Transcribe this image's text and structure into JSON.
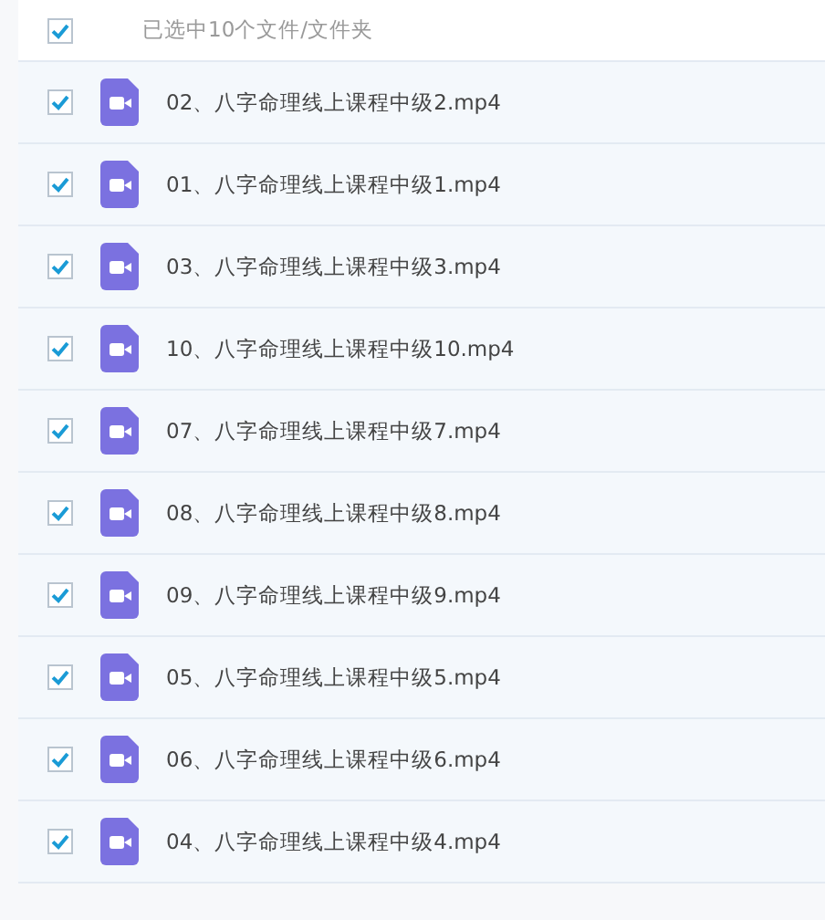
{
  "header": {
    "label": "已选中10个文件/文件夹",
    "checked": true
  },
  "files": [
    {
      "name": "02、八字命理线上课程中级2.mp4",
      "checked": true
    },
    {
      "name": "01、八字命理线上课程中级1.mp4",
      "checked": true
    },
    {
      "name": "03、八字命理线上课程中级3.mp4",
      "checked": true
    },
    {
      "name": "10、八字命理线上课程中级10.mp4",
      "checked": true
    },
    {
      "name": "07、八字命理线上课程中级7.mp4",
      "checked": true
    },
    {
      "name": "08、八字命理线上课程中级8.mp4",
      "checked": true
    },
    {
      "name": "09、八字命理线上课程中级9.mp4",
      "checked": true
    },
    {
      "name": "05、八字命理线上课程中级5.mp4",
      "checked": true
    },
    {
      "name": "06、八字命理线上课程中级6.mp4",
      "checked": true
    },
    {
      "name": "04、八字命理线上课程中级4.mp4",
      "checked": true
    }
  ]
}
